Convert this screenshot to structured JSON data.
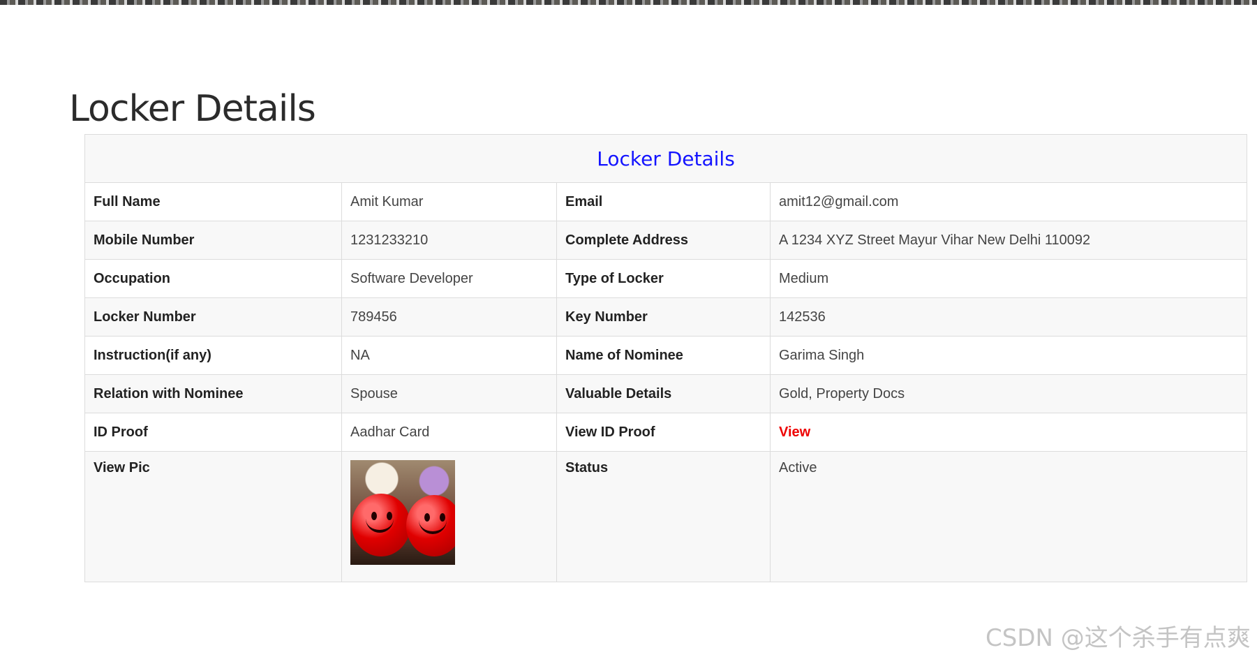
{
  "page": {
    "heading": "Locker Details",
    "watermark": "CSDN @这个杀手有点爽"
  },
  "table": {
    "caption": "Locker Details",
    "rows": [
      {
        "label1": "Full Name",
        "value1": "Amit Kumar",
        "label2": "Email",
        "value2": "amit12@gmail.com"
      },
      {
        "label1": "Mobile Number",
        "value1": "1231233210",
        "label2": "Complete Address",
        "value2": "A 1234 XYZ Street Mayur Vihar New Delhi 110092"
      },
      {
        "label1": "Occupation",
        "value1": "Software Developer",
        "label2": "Type of Locker",
        "value2": "Medium"
      },
      {
        "label1": "Locker Number",
        "value1": "789456",
        "label2": "Key Number",
        "value2": "142536"
      },
      {
        "label1": "Instruction(if any)",
        "value1": "NA",
        "label2": "Name of Nominee",
        "value2": "Garima Singh"
      },
      {
        "label1": "Relation with Nominee",
        "value1": "Spouse",
        "label2": "Valuable Details",
        "value2": "Gold, Property Docs"
      },
      {
        "label1": "ID Proof",
        "value1": "Aadhar Card",
        "label2": "View ID Proof",
        "value2": "View"
      },
      {
        "label1": "View Pic",
        "value1": "",
        "label2": "Status",
        "value2": "Active"
      }
    ]
  },
  "colors": {
    "caption": "#1414ff",
    "link": "#ee0000"
  },
  "icons": {
    "profile_pic": "red-smiley-balls-image"
  }
}
